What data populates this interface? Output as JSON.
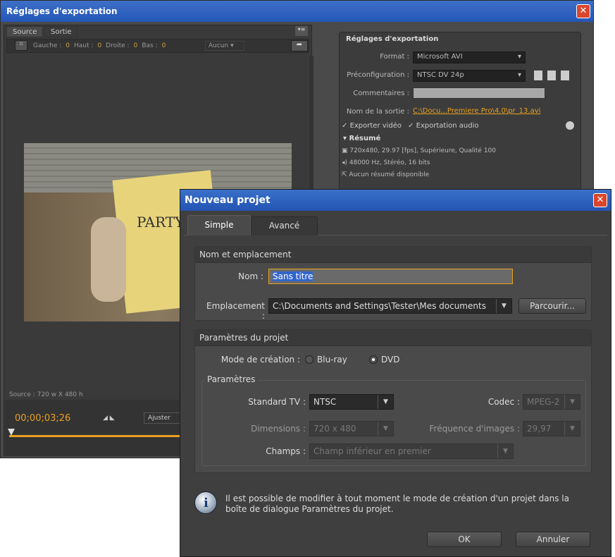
{
  "export": {
    "title": "Réglages d'exportation",
    "close": "✕",
    "tabs": [
      "Source",
      "Sortie"
    ],
    "crop": {
      "icon": "crop-icon",
      "left": "Gauche :",
      "left_val": "0",
      "top": "Haut :",
      "top_val": "0",
      "right": "Droite :",
      "right_val": "0",
      "bottom": "Bas :",
      "bottom_val": "0",
      "preset": "Aucun"
    },
    "source_info": "Source : 720 w X 480 h",
    "timecode": "00;00;03;26",
    "fit": "Ajuster",
    "panel_title": "Réglages d'exportation",
    "format_label": "Format :",
    "format_value": "Microsoft AVI",
    "preset_label": "Préconfiguration :",
    "preset_value": "NTSC DV 24p",
    "comments_label": "Commentaires :",
    "output_label": "Nom de la sortie :",
    "output_value": "C:\\Docu...Premiere Pro\\4.0\\pr_13.avi",
    "export_video": "Exporter vidéo",
    "export_audio": "Exportation audio",
    "summary": "Résumé",
    "summary_lines": [
      "720x480, 29.97 [fps], Supérieure, Qualité 100",
      "48000 Hz, Stéréo, 16 bits",
      "Aucun résumé disponible"
    ]
  },
  "dialog": {
    "title": "Nouveau projet",
    "close": "✕",
    "tabs": [
      "Simple",
      "Avancé"
    ],
    "loc_group": "Nom et emplacement",
    "name_label": "Nom :",
    "name_value": "Sans titre",
    "location_label": "Emplacement :",
    "location_value": "C:\\Documents and Settings\\Tester\\Mes documents",
    "browse": "Parcourir...",
    "proj_group": "Paramètres du projet",
    "mode_label": "Mode de création :",
    "mode_bluray": "Blu-ray",
    "mode_dvd": "DVD",
    "params_group": "Paramètres",
    "tv_label": "Standard TV :",
    "tv_value": "NTSC",
    "codec_label": "Codec :",
    "codec_value": "MPEG-2",
    "dim_label": "Dimensions :",
    "dim_value": "720 x 480",
    "fps_label": "Fréquence d'images :",
    "fps_value": "29,97",
    "fields_label": "Champs :",
    "fields_value": "Champ inférieur en premier",
    "info": "Il est possible de modifier à tout moment le mode de création d'un projet dans la boîte de dialogue Paramètres du projet.",
    "ok": "OK",
    "cancel": "Annuler"
  },
  "colors": {
    "accent": "#2356b8",
    "orange": "#e8a020"
  }
}
